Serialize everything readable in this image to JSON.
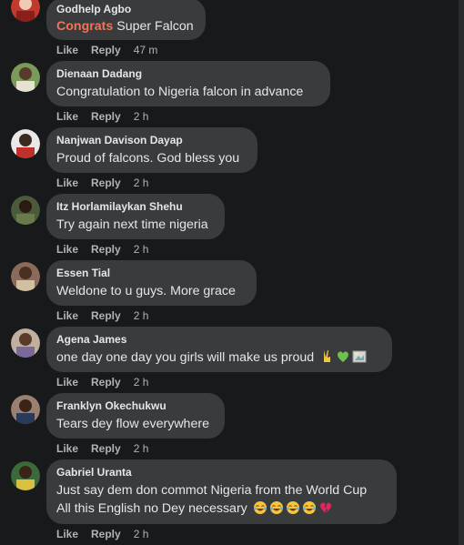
{
  "colors": {
    "background": "#18191a",
    "bubble": "#3a3b3c",
    "text": "#e4e6eb",
    "muted": "#b0b3b8",
    "tag": "#f0735b"
  },
  "actions": {
    "like": "Like",
    "reply": "Reply"
  },
  "comments": [
    {
      "author": "Godhelp Agbo",
      "tag": "Congrats",
      "text": "Super Falcon",
      "time": "47 m"
    },
    {
      "author": "Dienaan Dadang",
      "text": "Congratulation to Nigeria falcon in advance",
      "time": "2 h"
    },
    {
      "author": "Nanjwan Davison Dayap",
      "text": "Proud of falcons. God bless you",
      "time": "2 h"
    },
    {
      "author": "Itz Horlamilaykan Shehu",
      "text": "Try again next time nigeria",
      "time": "2 h"
    },
    {
      "author": "Essen Tial",
      "text": "Weldone to u guys. More grace",
      "time": "2 h"
    },
    {
      "author": "Agena James",
      "text": "one day one day you girls will make us proud",
      "emojis": [
        "victory-hand-icon",
        "green-heart-icon",
        "broken-image-icon"
      ],
      "time": "2 h"
    },
    {
      "author": "Franklyn Okechukwu",
      "text": "Tears dey flow everywhere",
      "time": "2 h"
    },
    {
      "author": "Gabriel Uranta",
      "text": "Just say dem don commot Nigeria from the World Cup",
      "text2": "All this English no Dey necessary",
      "emojis": [
        "tears-of-joy-icon",
        "tears-of-joy-icon",
        "tears-of-joy-icon",
        "tears-of-joy-icon",
        "broken-heart-icon"
      ],
      "time": "2 h"
    }
  ]
}
